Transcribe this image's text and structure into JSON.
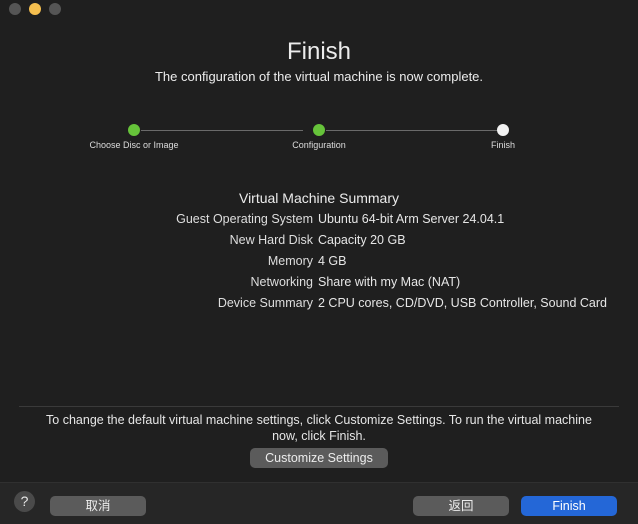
{
  "header": {
    "title": "Finish",
    "subtitle": "The configuration of the virtual machine is now complete."
  },
  "steps": [
    {
      "label": "Choose Disc or Image",
      "status": "done"
    },
    {
      "label": "Configuration",
      "status": "done"
    },
    {
      "label": "Finish",
      "status": "current"
    }
  ],
  "colors": {
    "step_done": "#66c33a",
    "step_current": "#f2f2f2",
    "primary_button": "#2467d7"
  },
  "summary": {
    "title": "Virtual Machine Summary",
    "rows": [
      {
        "key": "Guest Operating System",
        "value": "Ubuntu 64-bit Arm Server 24.04.1"
      },
      {
        "key": "New Hard Disk",
        "value": "Capacity 20 GB"
      },
      {
        "key": "Memory",
        "value": "4 GB"
      },
      {
        "key": "Networking",
        "value": "Share with my Mac (NAT)"
      },
      {
        "key": "Device Summary",
        "value": "2 CPU cores, CD/DVD, USB Controller, Sound Card"
      }
    ]
  },
  "hint": "To change the default virtual machine settings, click Customize Settings. To run the virtual machine now, click Finish.",
  "buttons": {
    "customize": "Customize Settings",
    "help": "?",
    "cancel": "取消",
    "back": "返回",
    "finish": "Finish"
  }
}
